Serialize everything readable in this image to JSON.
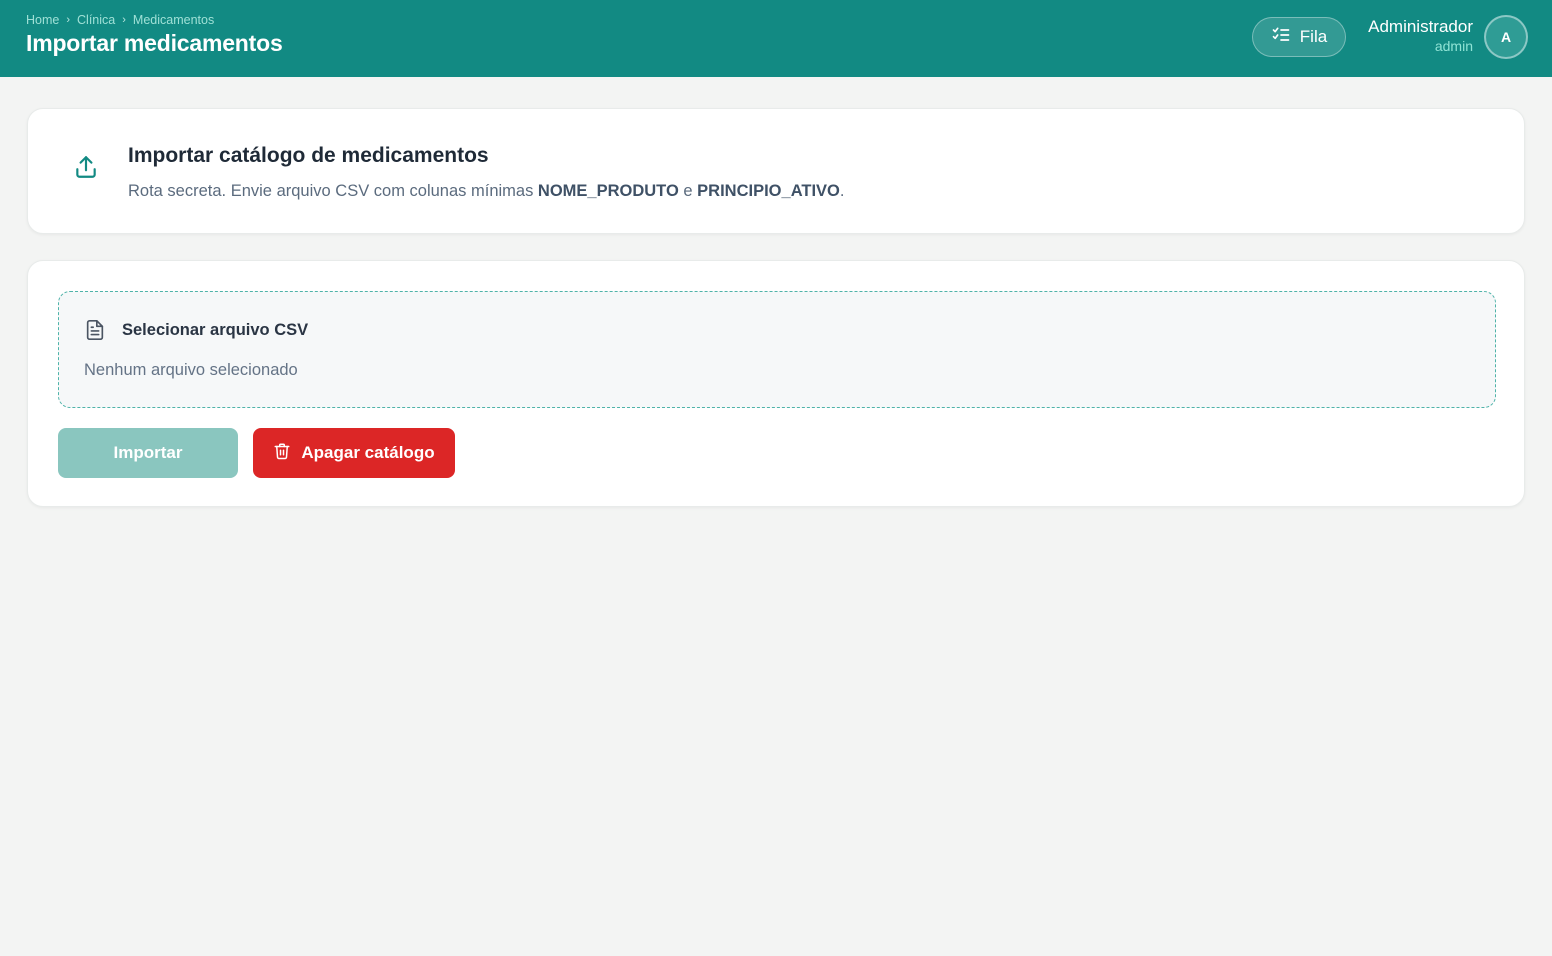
{
  "header": {
    "breadcrumb": [
      "Home",
      "Clínica",
      "Medicamentos"
    ],
    "breadcrumb_separator": "›",
    "title": "Importar medicamentos",
    "queue_button": {
      "label": "Fila",
      "icon": "list-checks-icon"
    },
    "user": {
      "name": "Administrador",
      "role": "admin",
      "avatar_initial": "A"
    }
  },
  "info_card": {
    "icon": "upload-icon",
    "title": "Importar catálogo de medicamentos",
    "description_prefix": "Rota secreta. Envie arquivo CSV com colunas mínimas ",
    "column_1": "NOME_PRODUTO",
    "description_joiner": " e ",
    "column_2": "PRINCIPIO_ATIVO",
    "description_suffix": "."
  },
  "upload_card": {
    "dropzone": {
      "icon": "file-text-icon",
      "label": "Selecionar arquivo CSV",
      "status": "Nenhum arquivo selecionado"
    },
    "import_button": {
      "label": "Importar",
      "disabled": true
    },
    "delete_button": {
      "label": "Apagar catálogo",
      "icon": "trash-icon"
    }
  },
  "colors": {
    "header_bg": "#128a83",
    "import_button_disabled": "#8ac6bf",
    "delete_button": "#dc2626",
    "page_bg": "#f3f4f3"
  }
}
